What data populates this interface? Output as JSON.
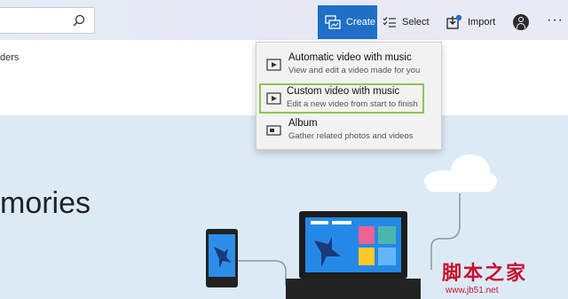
{
  "toolbar": {
    "create_label": "Create",
    "select_label": "Select",
    "import_label": "Import",
    "more_label": "···"
  },
  "left_panel": {
    "folders_text": "ders"
  },
  "hero": {
    "title_fragment": "mories"
  },
  "create_menu": {
    "items": [
      {
        "title": "Automatic video with music",
        "subtitle": "View and edit a video made for you",
        "icon": "video-music-icon"
      },
      {
        "title": "Custom video with music",
        "subtitle": "Edit a new video from start to finish",
        "icon": "video-music-icon",
        "highlighted": true
      },
      {
        "title": "Album",
        "subtitle": "Gather related photos and videos",
        "icon": "album-icon"
      }
    ]
  },
  "watermark": {
    "text": "脚本之家",
    "url": "www.jb51.net"
  },
  "colors": {
    "accent": "#1f6fc7",
    "highlight_border": "#8cc651",
    "hero_bg": "#dceaf6"
  }
}
